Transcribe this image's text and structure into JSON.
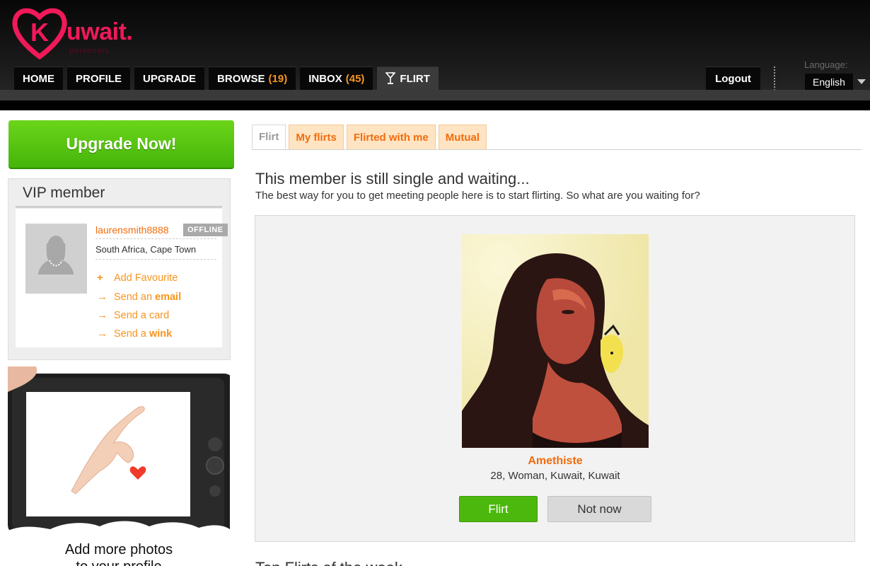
{
  "brand": {
    "logo_letter": "K",
    "name": "uwait.",
    "tagline": "personals"
  },
  "nav": {
    "tabs": [
      {
        "label": "HOME",
        "count": ""
      },
      {
        "label": "PROFILE",
        "count": ""
      },
      {
        "label": "UPGRADE",
        "count": ""
      },
      {
        "label": "BROWSE",
        "count": "(19)"
      },
      {
        "label": "INBOX",
        "count": "(45)"
      },
      {
        "label": "FLIRT",
        "count": "",
        "icon": "cocktail-glass-icon"
      }
    ],
    "logout": "Logout",
    "language_label": "Language:",
    "language_value": "English"
  },
  "sidebar": {
    "upgrade_button": "Upgrade Now!",
    "vip_title": "VIP member",
    "member": {
      "username": "laurensmith8888",
      "status": "OFFLINE",
      "location": "South Africa, Cape Town"
    },
    "actions": [
      {
        "prefix": "Add Favourite",
        "bold": "",
        "icon": "plus-icon"
      },
      {
        "prefix": "Send an",
        "bold": "email",
        "icon": "arrow-right-icon"
      },
      {
        "prefix": "Send a card",
        "bold": "",
        "icon": "arrow-right-icon"
      },
      {
        "prefix": "Send a",
        "bold": "wink",
        "icon": "arrow-right-icon"
      }
    ],
    "promo_line1": "Add more photos",
    "promo_line2": "to your profile"
  },
  "main": {
    "tabs": [
      "Flirt",
      "My flirts",
      "Flirted with me",
      "Mutual"
    ],
    "title": "This member is still single and waiting...",
    "subtitle": "The best way for you to get meeting people here is to start flirting. So what are you waiting for?",
    "profile": {
      "name": "Amethiste",
      "info": "28, Woman, Kuwait, Kuwait"
    },
    "flirt_button": "Flirt",
    "not_now_button": "Not now",
    "section_title": "Top Flirts of the week"
  },
  "colors": {
    "accent": "#f26c0d",
    "green": "#4cb80d",
    "brand_pink": "#f0195a"
  }
}
